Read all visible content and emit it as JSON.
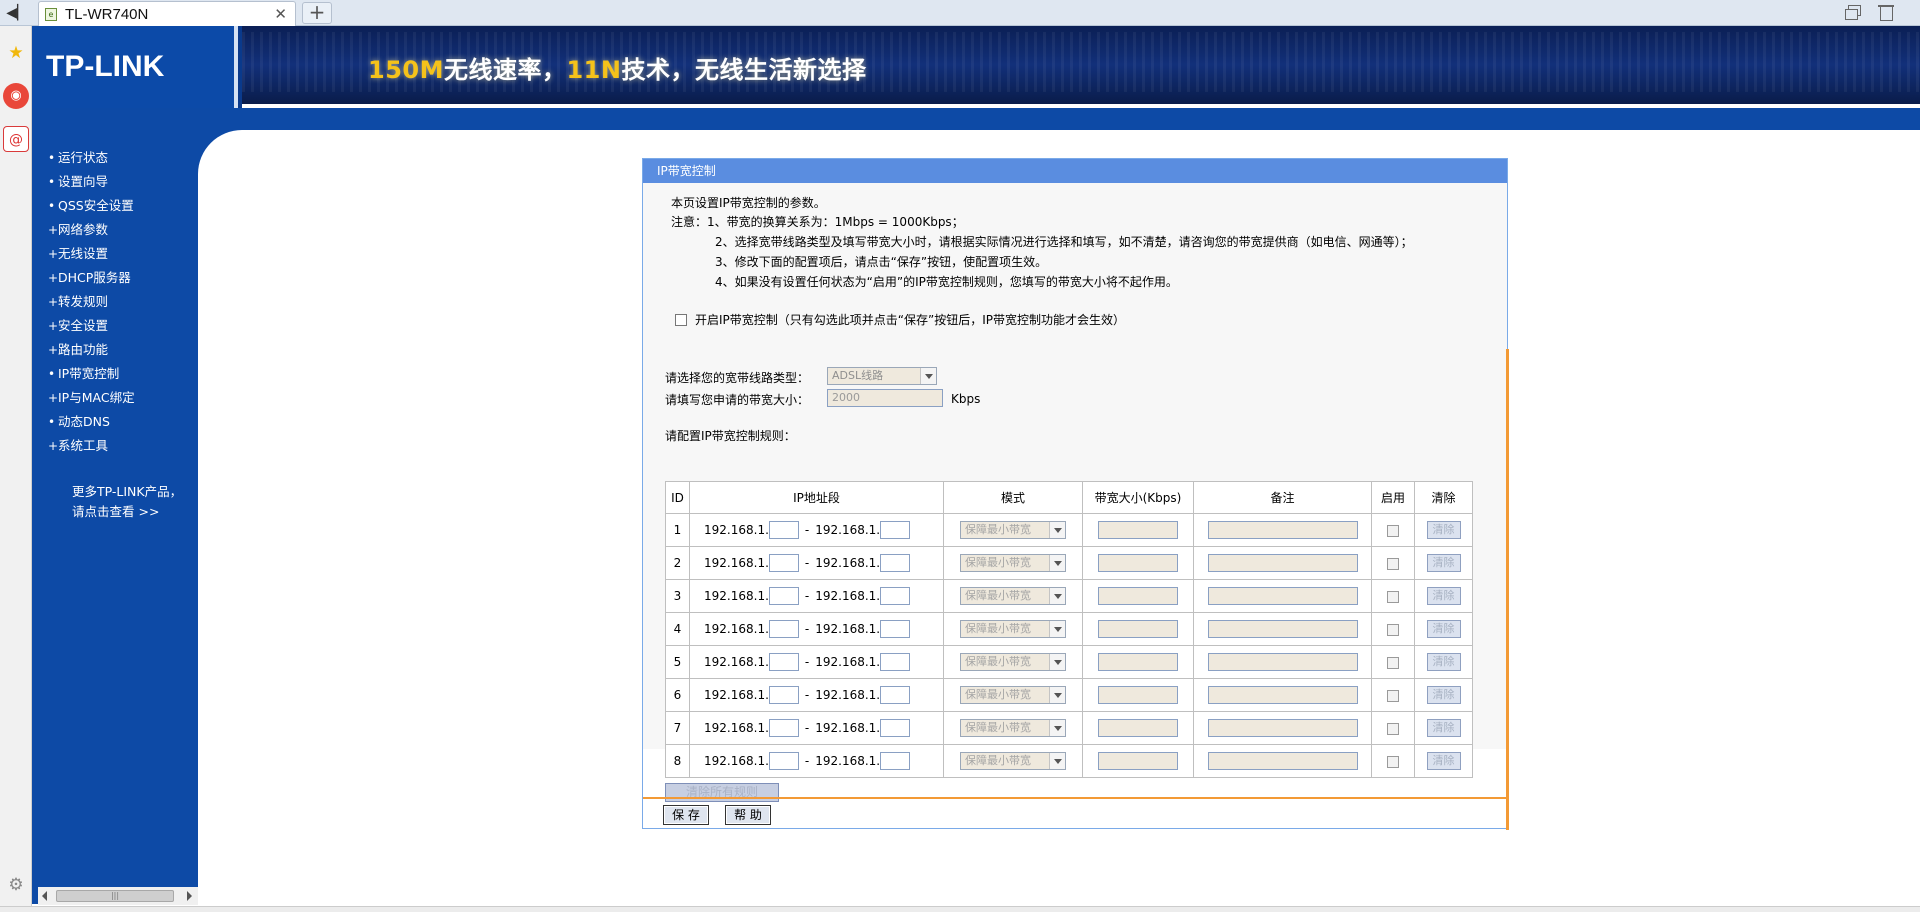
{
  "browser": {
    "tab_title": "TL-WR740N",
    "new_tab": "+",
    "close": "✕"
  },
  "header": {
    "logo": "TP-LINK",
    "slogan_a": "150M",
    "slogan_b": "无线速率，",
    "slogan_c": "11N",
    "slogan_d": "技术，无线生活新选择"
  },
  "menu": {
    "items": [
      {
        "bullet": "•",
        "label": "运行状态"
      },
      {
        "bullet": "•",
        "label": "设置向导"
      },
      {
        "bullet": "•",
        "label": "QSS安全设置"
      },
      {
        "bullet": "+",
        "label": "网络参数"
      },
      {
        "bullet": "+",
        "label": "无线设置"
      },
      {
        "bullet": "+",
        "label": "DHCP服务器"
      },
      {
        "bullet": "+",
        "label": "转发规则"
      },
      {
        "bullet": "+",
        "label": "安全设置"
      },
      {
        "bullet": "+",
        "label": "路由功能"
      },
      {
        "bullet": "•",
        "label": "IP带宽控制"
      },
      {
        "bullet": "+",
        "label": "IP与MAC绑定"
      },
      {
        "bullet": "•",
        "label": "动态DNS"
      },
      {
        "bullet": "+",
        "label": "系统工具"
      }
    ],
    "more_1": "更多TP-LINK产品，",
    "more_2": "请点击查看 >>"
  },
  "panel": {
    "title": "IP带宽控制",
    "desc": "本页设置IP带宽控制的参数。",
    "note_1": "注意：1、带宽的换算关系为：1Mbps = 1000Kbps；",
    "note_2": "2、选择宽带线路类型及填写带宽大小时，请根据实际情况进行选择和填写，如不清楚，请咨询您的带宽提供商（如电信、网通等）；",
    "note_3": "3、修改下面的配置项后，请点击“保存”按钮，使配置项生效。",
    "note_4": "4、如果没有设置任何状态为“启用”的IP带宽控制规则，您填写的带宽大小将不起作用。",
    "enable_label": "开启IP带宽控制（只有勾选此项并点击“保存”按钮后，IP带宽控制功能才会生效）",
    "line_type_label": "请选择您的宽带线路类型：",
    "line_type_value": "ADSL线路",
    "bandwidth_label": "请填写您申请的带宽大小：",
    "bandwidth_value": "2000",
    "bandwidth_unit": "Kbps",
    "rules_label": "请配置IP带宽控制规则：",
    "table_headers": [
      "ID",
      "IP地址段",
      "模式",
      "带宽大小(Kbps)",
      "备注",
      "启用",
      "清除"
    ],
    "ip_prefix": "192.168.1.",
    "ip_dash": "-",
    "mode_value": "保障最小带宽",
    "clear_label": "清除",
    "row_ids": [
      "1",
      "2",
      "3",
      "4",
      "5",
      "6",
      "7",
      "8"
    ],
    "clear_all": "清除所有规则",
    "save": "保 存",
    "help": "帮 助"
  }
}
